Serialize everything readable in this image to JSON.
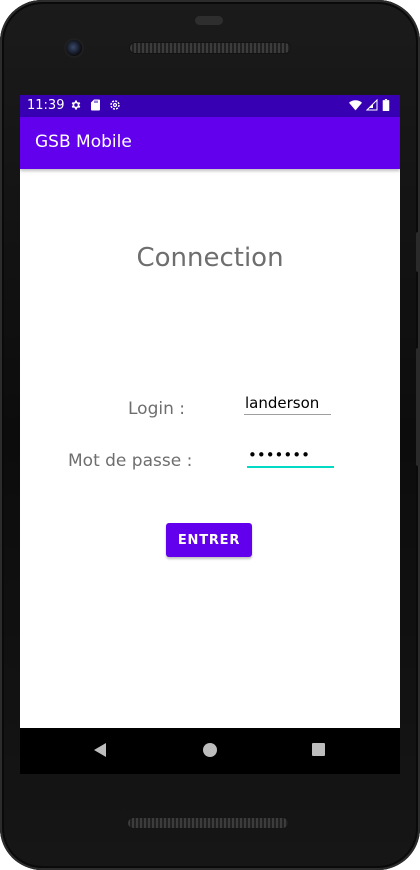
{
  "status_bar": {
    "time": "11:39",
    "icons_left": [
      "settings-icon",
      "sd-card-icon",
      "settings-alt-icon"
    ],
    "icons_right": [
      "wifi-icon",
      "cell-signal-icon",
      "battery-icon"
    ],
    "background_color": "#3700b3"
  },
  "app_bar": {
    "title": "GSB Mobile",
    "background_color": "#6200ee"
  },
  "main": {
    "heading": "Connection",
    "login": {
      "label": "Login :",
      "value": "landerson"
    },
    "password": {
      "label": "Mot de passe :",
      "value": "•••••••"
    },
    "enter_button": {
      "label": "ENTRER",
      "color": "#6200ee"
    }
  },
  "navigation_bar": {
    "buttons": [
      "back-icon",
      "home-icon",
      "recents-icon"
    ]
  },
  "colors": {
    "primary": "#6200ee",
    "primary_dark": "#3700b3",
    "accent": "#03dac5",
    "label_text": "#6e6e6e"
  }
}
